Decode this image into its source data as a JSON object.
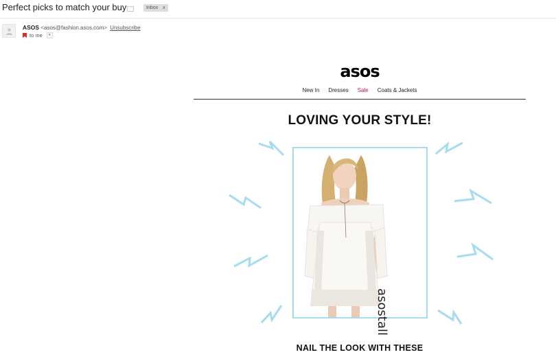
{
  "email": {
    "subject": "Perfect picks to match your buy",
    "label_chip": {
      "text": "Inbox",
      "close": "x"
    },
    "sender": {
      "name": "ASOS",
      "address": "<asos@fashion.asos.com>",
      "unsubscribe": "Unsubscribe",
      "recipient": "to me"
    }
  },
  "newsletter": {
    "logo": "asos",
    "nav": [
      "New In",
      "Dresses",
      "Sale",
      "Coats & Jackets"
    ],
    "headline": "LOVING YOUR STYLE!",
    "product_brand": "asostall",
    "subheadline": "NAIL THE LOOK WITH THESE"
  },
  "colors": {
    "sale": "#d01345",
    "accent_blue": "#a6dcf0"
  }
}
